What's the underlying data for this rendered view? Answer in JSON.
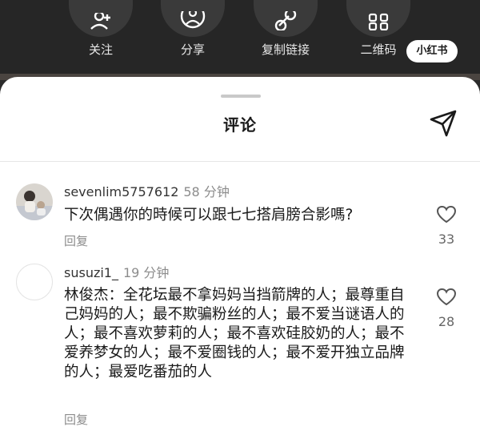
{
  "share_bar": {
    "actions": [
      {
        "label": "关注",
        "icon": "follow-icon"
      },
      {
        "label": "分享",
        "icon": "share-icon"
      },
      {
        "label": "复制链接",
        "icon": "link-icon"
      },
      {
        "label": "二维码",
        "icon": "qr-code-icon"
      }
    ],
    "watermark": "小红书"
  },
  "sheet": {
    "title": "评论",
    "send_icon": "send-icon"
  },
  "comments": [
    {
      "username": "sevenlim5757612",
      "time": "58 分钟",
      "text": "下次偶遇你的時候可以跟七七搭肩膀合影嗎?",
      "reply_label": "回复",
      "likes": "33"
    },
    {
      "username": "susuzi1_",
      "time": "19 分钟",
      "text": "林俊杰：全花坛最不拿妈妈当挡箭牌的人；最尊重自己妈妈的人；最不欺骗粉丝的人；最不爱当谜语人的人；最不喜欢萝莉的人；最不喜欢硅胶奶的人；最不爱养梦女的人；最不爱圈钱的人；最不爱开独立品牌的人；最爱吃番茄的人",
      "reply_label": "回复",
      "likes": "28"
    }
  ],
  "colors": {
    "background_dark": "#262626",
    "sheet": "#ffffff",
    "muted_text": "#8c8c8c"
  }
}
